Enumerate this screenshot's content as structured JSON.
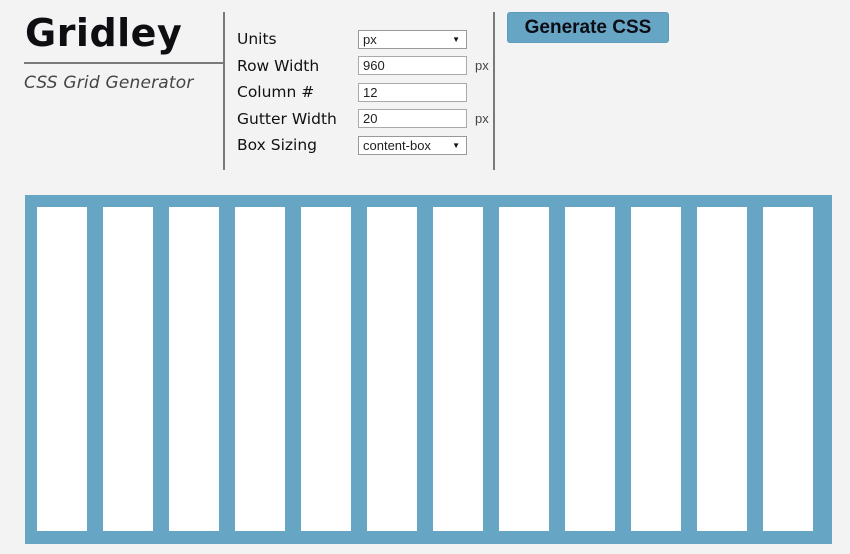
{
  "brand": {
    "title": "Gridley",
    "subtitle": "CSS Grid Generator"
  },
  "form": {
    "units": {
      "label": "Units",
      "value": "px"
    },
    "row_width": {
      "label": "Row Width",
      "value": "960",
      "unit": "px"
    },
    "column_count": {
      "label": "Column #",
      "value": "12"
    },
    "gutter_width": {
      "label": "Gutter Width",
      "value": "20",
      "unit": "px"
    },
    "box_sizing": {
      "label": "Box Sizing",
      "value": "content-box"
    }
  },
  "actions": {
    "generate_label": "Generate CSS"
  },
  "preview": {
    "columns": 12
  },
  "colors": {
    "accent": "#67a5c4",
    "background": "#f3f3f3",
    "column": "#ffffff"
  }
}
